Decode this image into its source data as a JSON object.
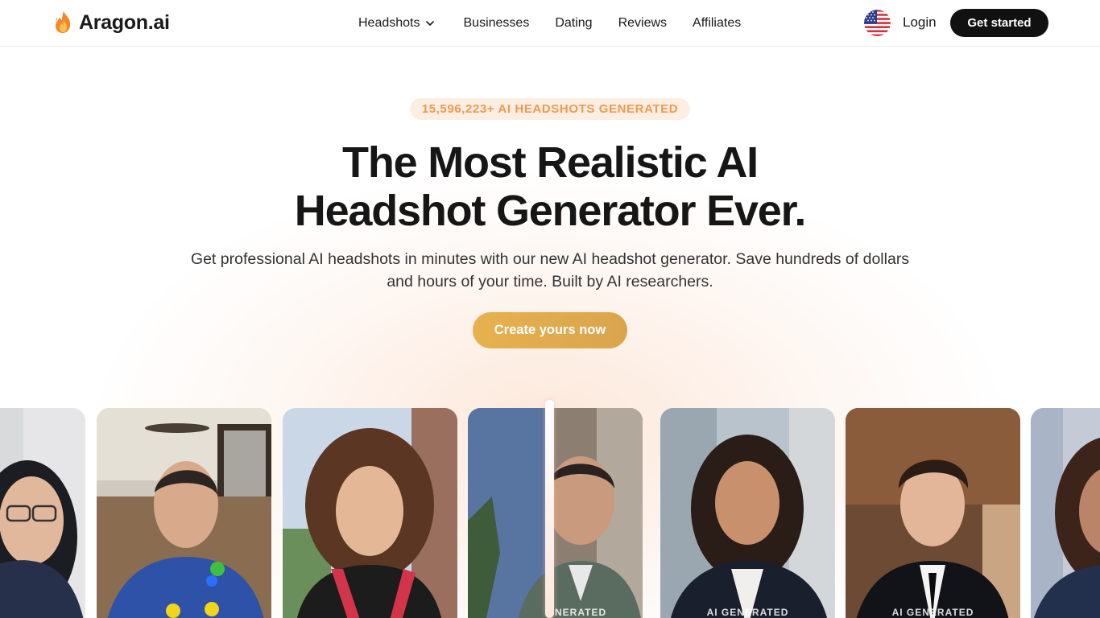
{
  "brand": {
    "name": "Aragon.ai",
    "accent": "#ef9a4a",
    "cta_color": "#e2ab4e"
  },
  "nav": {
    "items": [
      {
        "label": "Headshots",
        "has_dropdown": true
      },
      {
        "label": "Businesses"
      },
      {
        "label": "Dating"
      },
      {
        "label": "Reviews"
      },
      {
        "label": "Affiliates"
      }
    ],
    "flag_icon": "us-flag-icon",
    "login_label": "Login",
    "get_started_label": "Get started"
  },
  "hero": {
    "badge": "15,596,223+ AI HEADSHOTS GENERATED",
    "headline_line1": "The Most Realistic AI",
    "headline_line2": "Headshot Generator Ever.",
    "subtext": "Get professional AI headshots in minutes with our new AI headshot generator. Save hundreds of dollars and hours of your time. Built by AI researchers.",
    "cta_label": "Create yours now"
  },
  "cards": {
    "ai_label": "AI GENERATED",
    "partial_label_a": "NERATED"
  }
}
